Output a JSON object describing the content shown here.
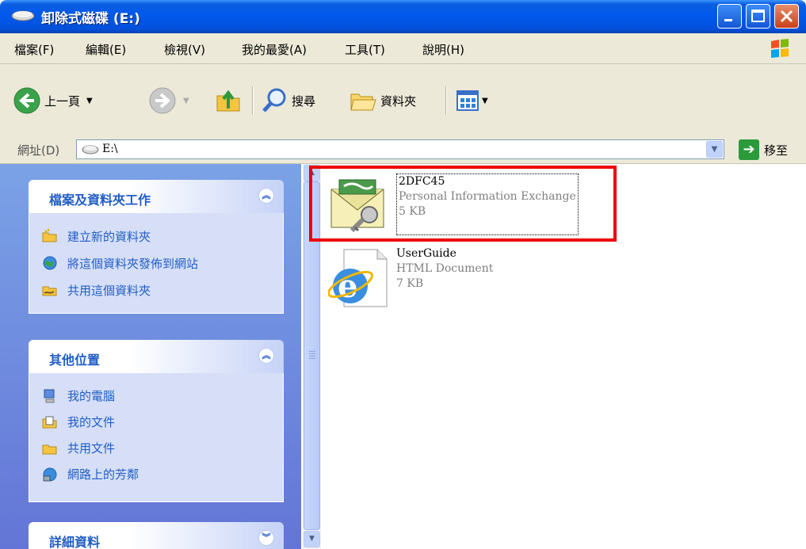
{
  "window": {
    "title": "卸除式磁碟 (E:)"
  },
  "menu": {
    "items": [
      "檔案(F)",
      "編輯(E)",
      "檢視(V)",
      "我的最愛(A)",
      "工具(T)",
      "說明(H)"
    ]
  },
  "toolbar": {
    "back_label": "上一頁",
    "search_label": "搜尋",
    "folders_label": "資料夾"
  },
  "address": {
    "label": "網址(D)",
    "value": "E:\\",
    "go_label": "移至"
  },
  "taskpane": {
    "file_tasks": {
      "title": "檔案及資料夾工作",
      "items": [
        "建立新的資料夾",
        "將這個資料夾發佈到網站",
        "共用這個資料夾"
      ]
    },
    "other_places": {
      "title": "其他位置",
      "items": [
        "我的電腦",
        "我的文件",
        "共用文件",
        "網路上的芳鄰"
      ]
    },
    "details": {
      "title": "詳細資料"
    }
  },
  "files": [
    {
      "name": "2DFC45",
      "type": "Personal Information Exchange",
      "size": "5 KB",
      "selected": true
    },
    {
      "name": "UserGuide",
      "type": "HTML Document",
      "size": "7 KB",
      "selected": false
    }
  ],
  "colors": {
    "titlebar": "#0058ee",
    "taskpane": "#6375d6",
    "link": "#215dc6",
    "highlight": "#e00000"
  },
  "icons": [
    "drive-icon",
    "back-icon",
    "forward-icon",
    "up-folder-icon",
    "search-icon",
    "folders-icon",
    "views-icon",
    "pfx-certificate-icon",
    "ie-html-icon"
  ]
}
